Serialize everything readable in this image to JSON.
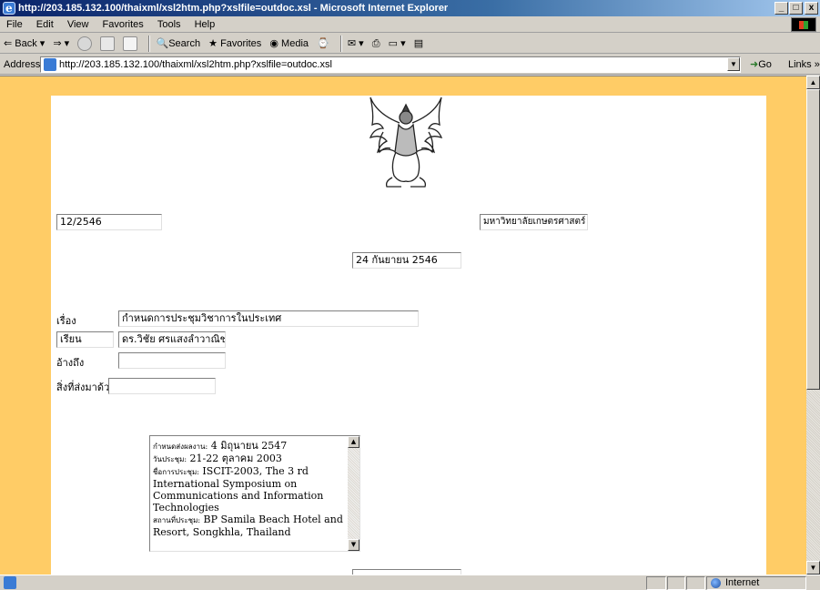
{
  "window": {
    "title": "http://203.185.132.100/thaixml/xsl2htm.php?xslfile=outdoc.xsl - Microsoft Internet Explorer",
    "minimize_glyph": "_",
    "restore_glyph": "□",
    "close_glyph": "x"
  },
  "menu": [
    "File",
    "Edit",
    "View",
    "Favorites",
    "Tools",
    "Help"
  ],
  "toolbar": {
    "back": "Back",
    "search": "Search",
    "favorites": "Favorites",
    "media": "Media"
  },
  "address": {
    "label": "Address",
    "url": "http://203.185.132.100/thaixml/xsl2htm.php?xslfile=outdoc.xsl",
    "go": "Go",
    "links": "Links »"
  },
  "document": {
    "doc_number": "12/2546",
    "organization": "มหาวิทยาลัยเกษตรศาสตร์",
    "date": "24 กันยายน 2546",
    "subject_label": "เรื่อง",
    "subject_value": "กำหนดการประชุมวิชาการในประเทศ",
    "to_label": "เรียน",
    "to_value": "ดร.วิชัย ศรแสงลำวาณิช",
    "ref_label": "อ้างถึง",
    "ref_value": "",
    "attachment_label": "สิ่งที่ส่งมาด้วย",
    "attachment_value": "",
    "details": {
      "deadline_label": "กำหนดส่งผลงาน:",
      "deadline_value": " 4 มิถุนายน 2547",
      "date_label": "วันประชุม:",
      "date_value": " 21-22 ตุลาคม 2003",
      "name_label": "ชื่อการประชุม:",
      "name_value": " ISCIT-2003, The 3 rd International Symposium on Communications and Information Technologies",
      "venue_label": "สถานที่ประชุม:",
      "venue_value": " BP Samila Beach Hotel and Resort, Songkhla, Thailand"
    }
  },
  "status": {
    "zone": "Internet"
  }
}
